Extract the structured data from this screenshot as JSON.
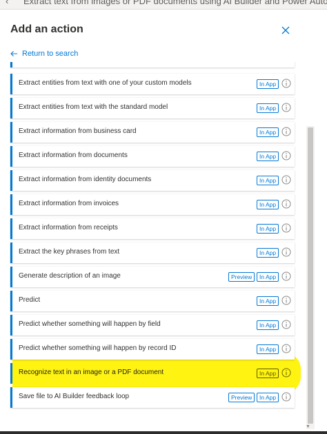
{
  "window": {
    "title": "Extract text from images or PDF documents using AI Builder and Power Automate"
  },
  "panel": {
    "title": "Add an action",
    "return_label": "Return to search"
  },
  "badges": {
    "in_app": "In App",
    "preview": "Preview"
  },
  "colors": {
    "accent": "#0078d4",
    "highlight": "#fff200"
  },
  "actions": [
    {
      "label": "Extract entities from text with one of your custom models",
      "badges": [
        "In App"
      ]
    },
    {
      "label": "Extract entities from text with the standard model",
      "badges": [
        "In App"
      ]
    },
    {
      "label": "Extract information from business card",
      "badges": [
        "In App"
      ]
    },
    {
      "label": "Extract information from documents",
      "badges": [
        "In App"
      ]
    },
    {
      "label": "Extract information from identity documents",
      "badges": [
        "In App"
      ]
    },
    {
      "label": "Extract information from invoices",
      "badges": [
        "In App"
      ]
    },
    {
      "label": "Extract information from receipts",
      "badges": [
        "In App"
      ]
    },
    {
      "label": "Extract the key phrases from text",
      "badges": [
        "In App"
      ]
    },
    {
      "label": "Generate description of an image",
      "badges": [
        "Preview",
        "In App"
      ]
    },
    {
      "label": "Predict",
      "badges": [
        "In App"
      ]
    },
    {
      "label": "Predict whether something will happen by field",
      "badges": [
        "In App"
      ]
    },
    {
      "label": "Predict whether something will happen by record ID",
      "badges": [
        "In App"
      ]
    },
    {
      "label": "Recognize text in an image or a PDF document",
      "badges": [
        "In App"
      ],
      "highlighted": true
    },
    {
      "label": "Save file to AI Builder feedback loop",
      "badges": [
        "Preview",
        "In App"
      ]
    }
  ]
}
